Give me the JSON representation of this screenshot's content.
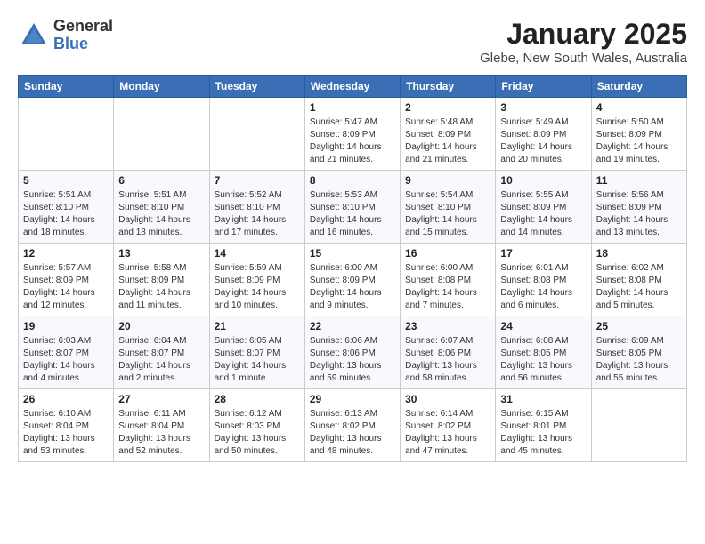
{
  "logo": {
    "general": "General",
    "blue": "Blue"
  },
  "header": {
    "month": "January 2025",
    "location": "Glebe, New South Wales, Australia"
  },
  "weekdays": [
    "Sunday",
    "Monday",
    "Tuesday",
    "Wednesday",
    "Thursday",
    "Friday",
    "Saturday"
  ],
  "weeks": [
    [
      {
        "day": "",
        "info": ""
      },
      {
        "day": "",
        "info": ""
      },
      {
        "day": "",
        "info": ""
      },
      {
        "day": "1",
        "info": "Sunrise: 5:47 AM\nSunset: 8:09 PM\nDaylight: 14 hours\nand 21 minutes."
      },
      {
        "day": "2",
        "info": "Sunrise: 5:48 AM\nSunset: 8:09 PM\nDaylight: 14 hours\nand 21 minutes."
      },
      {
        "day": "3",
        "info": "Sunrise: 5:49 AM\nSunset: 8:09 PM\nDaylight: 14 hours\nand 20 minutes."
      },
      {
        "day": "4",
        "info": "Sunrise: 5:50 AM\nSunset: 8:09 PM\nDaylight: 14 hours\nand 19 minutes."
      }
    ],
    [
      {
        "day": "5",
        "info": "Sunrise: 5:51 AM\nSunset: 8:10 PM\nDaylight: 14 hours\nand 18 minutes."
      },
      {
        "day": "6",
        "info": "Sunrise: 5:51 AM\nSunset: 8:10 PM\nDaylight: 14 hours\nand 18 minutes."
      },
      {
        "day": "7",
        "info": "Sunrise: 5:52 AM\nSunset: 8:10 PM\nDaylight: 14 hours\nand 17 minutes."
      },
      {
        "day": "8",
        "info": "Sunrise: 5:53 AM\nSunset: 8:10 PM\nDaylight: 14 hours\nand 16 minutes."
      },
      {
        "day": "9",
        "info": "Sunrise: 5:54 AM\nSunset: 8:10 PM\nDaylight: 14 hours\nand 15 minutes."
      },
      {
        "day": "10",
        "info": "Sunrise: 5:55 AM\nSunset: 8:09 PM\nDaylight: 14 hours\nand 14 minutes."
      },
      {
        "day": "11",
        "info": "Sunrise: 5:56 AM\nSunset: 8:09 PM\nDaylight: 14 hours\nand 13 minutes."
      }
    ],
    [
      {
        "day": "12",
        "info": "Sunrise: 5:57 AM\nSunset: 8:09 PM\nDaylight: 14 hours\nand 12 minutes."
      },
      {
        "day": "13",
        "info": "Sunrise: 5:58 AM\nSunset: 8:09 PM\nDaylight: 14 hours\nand 11 minutes."
      },
      {
        "day": "14",
        "info": "Sunrise: 5:59 AM\nSunset: 8:09 PM\nDaylight: 14 hours\nand 10 minutes."
      },
      {
        "day": "15",
        "info": "Sunrise: 6:00 AM\nSunset: 8:09 PM\nDaylight: 14 hours\nand 9 minutes."
      },
      {
        "day": "16",
        "info": "Sunrise: 6:00 AM\nSunset: 8:08 PM\nDaylight: 14 hours\nand 7 minutes."
      },
      {
        "day": "17",
        "info": "Sunrise: 6:01 AM\nSunset: 8:08 PM\nDaylight: 14 hours\nand 6 minutes."
      },
      {
        "day": "18",
        "info": "Sunrise: 6:02 AM\nSunset: 8:08 PM\nDaylight: 14 hours\nand 5 minutes."
      }
    ],
    [
      {
        "day": "19",
        "info": "Sunrise: 6:03 AM\nSunset: 8:07 PM\nDaylight: 14 hours\nand 4 minutes."
      },
      {
        "day": "20",
        "info": "Sunrise: 6:04 AM\nSunset: 8:07 PM\nDaylight: 14 hours\nand 2 minutes."
      },
      {
        "day": "21",
        "info": "Sunrise: 6:05 AM\nSunset: 8:07 PM\nDaylight: 14 hours\nand 1 minute."
      },
      {
        "day": "22",
        "info": "Sunrise: 6:06 AM\nSunset: 8:06 PM\nDaylight: 13 hours\nand 59 minutes."
      },
      {
        "day": "23",
        "info": "Sunrise: 6:07 AM\nSunset: 8:06 PM\nDaylight: 13 hours\nand 58 minutes."
      },
      {
        "day": "24",
        "info": "Sunrise: 6:08 AM\nSunset: 8:05 PM\nDaylight: 13 hours\nand 56 minutes."
      },
      {
        "day": "25",
        "info": "Sunrise: 6:09 AM\nSunset: 8:05 PM\nDaylight: 13 hours\nand 55 minutes."
      }
    ],
    [
      {
        "day": "26",
        "info": "Sunrise: 6:10 AM\nSunset: 8:04 PM\nDaylight: 13 hours\nand 53 minutes."
      },
      {
        "day": "27",
        "info": "Sunrise: 6:11 AM\nSunset: 8:04 PM\nDaylight: 13 hours\nand 52 minutes."
      },
      {
        "day": "28",
        "info": "Sunrise: 6:12 AM\nSunset: 8:03 PM\nDaylight: 13 hours\nand 50 minutes."
      },
      {
        "day": "29",
        "info": "Sunrise: 6:13 AM\nSunset: 8:02 PM\nDaylight: 13 hours\nand 48 minutes."
      },
      {
        "day": "30",
        "info": "Sunrise: 6:14 AM\nSunset: 8:02 PM\nDaylight: 13 hours\nand 47 minutes."
      },
      {
        "day": "31",
        "info": "Sunrise: 6:15 AM\nSunset: 8:01 PM\nDaylight: 13 hours\nand 45 minutes."
      },
      {
        "day": "",
        "info": ""
      }
    ]
  ]
}
